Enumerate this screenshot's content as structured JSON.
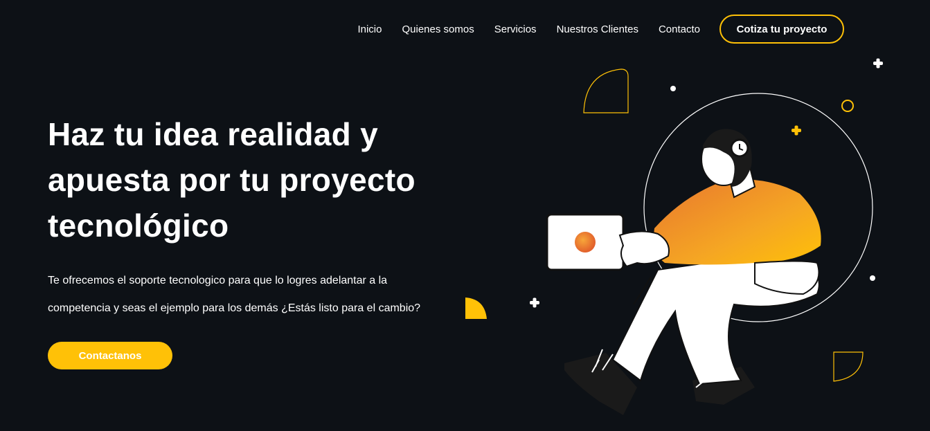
{
  "nav": {
    "items": [
      {
        "label": "Inicio"
      },
      {
        "label": "Quienes somos"
      },
      {
        "label": "Servicios"
      },
      {
        "label": "Nuestros Clientes"
      },
      {
        "label": "Contacto"
      }
    ],
    "cta_label": "Cotiza tu proyecto"
  },
  "hero": {
    "title_lines": [
      "Haz tu idea realidad y",
      "apuesta por tu proyecto",
      "tecnológico"
    ],
    "description_lines": [
      "Te ofrecemos el soporte tecnologico para que lo logres adelantar a la",
      "competencia y seas el ejemplo para los demás ¿Estás listo para el cambio?"
    ],
    "cta_label": "Contactanos"
  },
  "illustration": {
    "icon": "person-with-laptop-illustration"
  },
  "colors": {
    "background": "#0d1116",
    "accent": "#ffc107",
    "text": "#ffffff"
  }
}
